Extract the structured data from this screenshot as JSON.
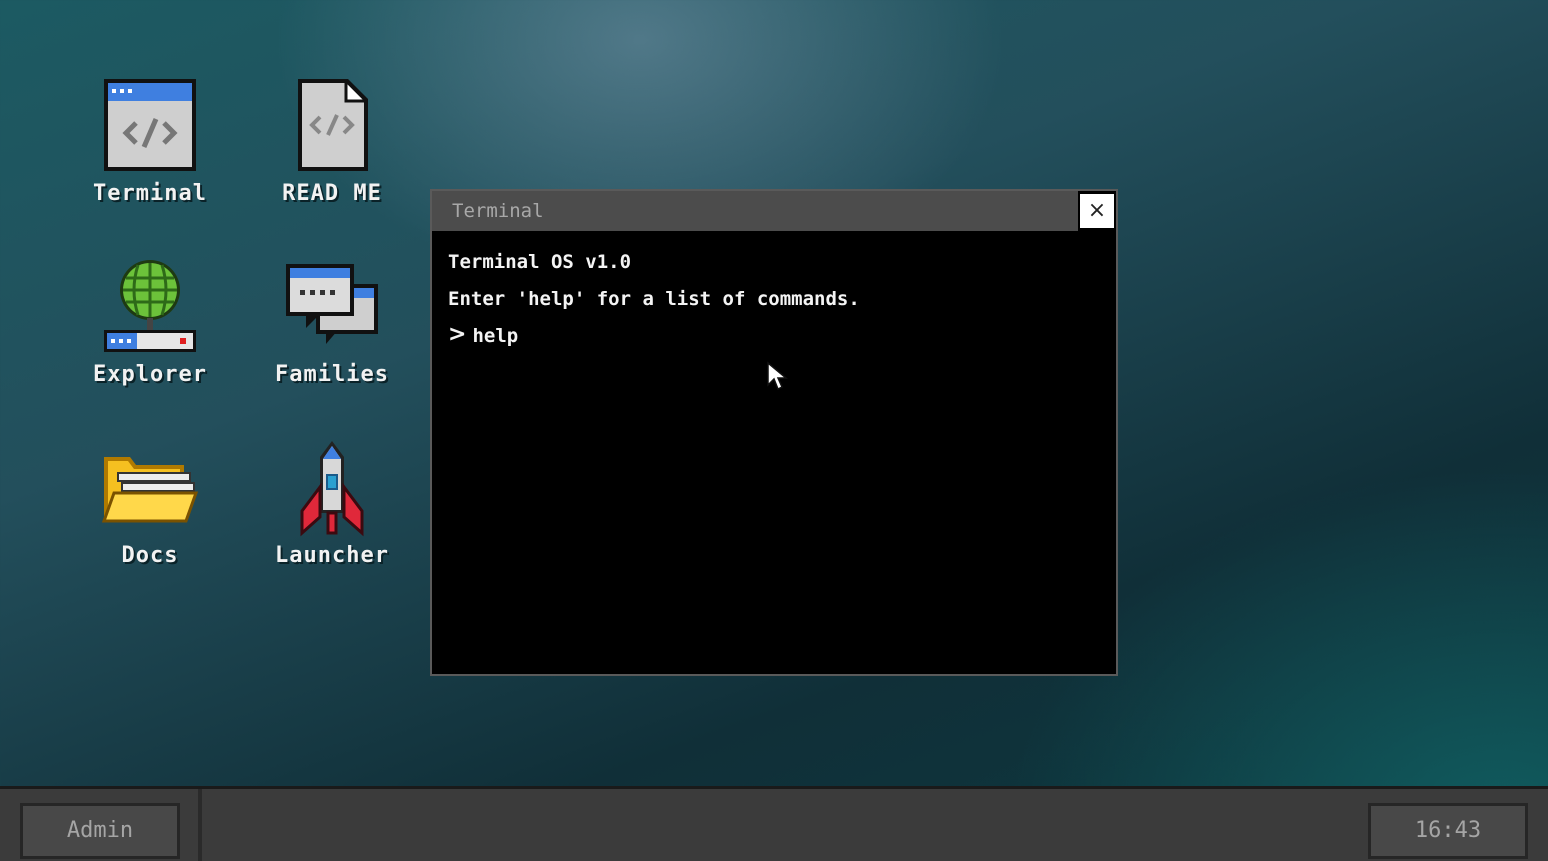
{
  "desktop": {
    "icons": [
      {
        "label": "Terminal",
        "icon": "terminal-code-window-icon"
      },
      {
        "label": "READ ME",
        "icon": "code-document-icon"
      },
      {
        "label": "Explorer",
        "icon": "globe-network-icon"
      },
      {
        "label": "Families",
        "icon": "chat-bubbles-icon"
      },
      {
        "label": "Docs",
        "icon": "folder-icon"
      },
      {
        "label": "Launcher",
        "icon": "rocket-icon"
      }
    ]
  },
  "window": {
    "title": "Terminal",
    "close_glyph": "×",
    "lines": [
      "Terminal OS v1.0",
      "Enter 'help' for a list of commands."
    ],
    "prompt_symbol": ">",
    "command": "help"
  },
  "taskbar": {
    "user_button": "Admin",
    "clock": "16:43"
  },
  "colors": {
    "terminal_bg": "#000000",
    "titlebar": "#4c4c4c",
    "taskbar": "#3b3b3b"
  }
}
